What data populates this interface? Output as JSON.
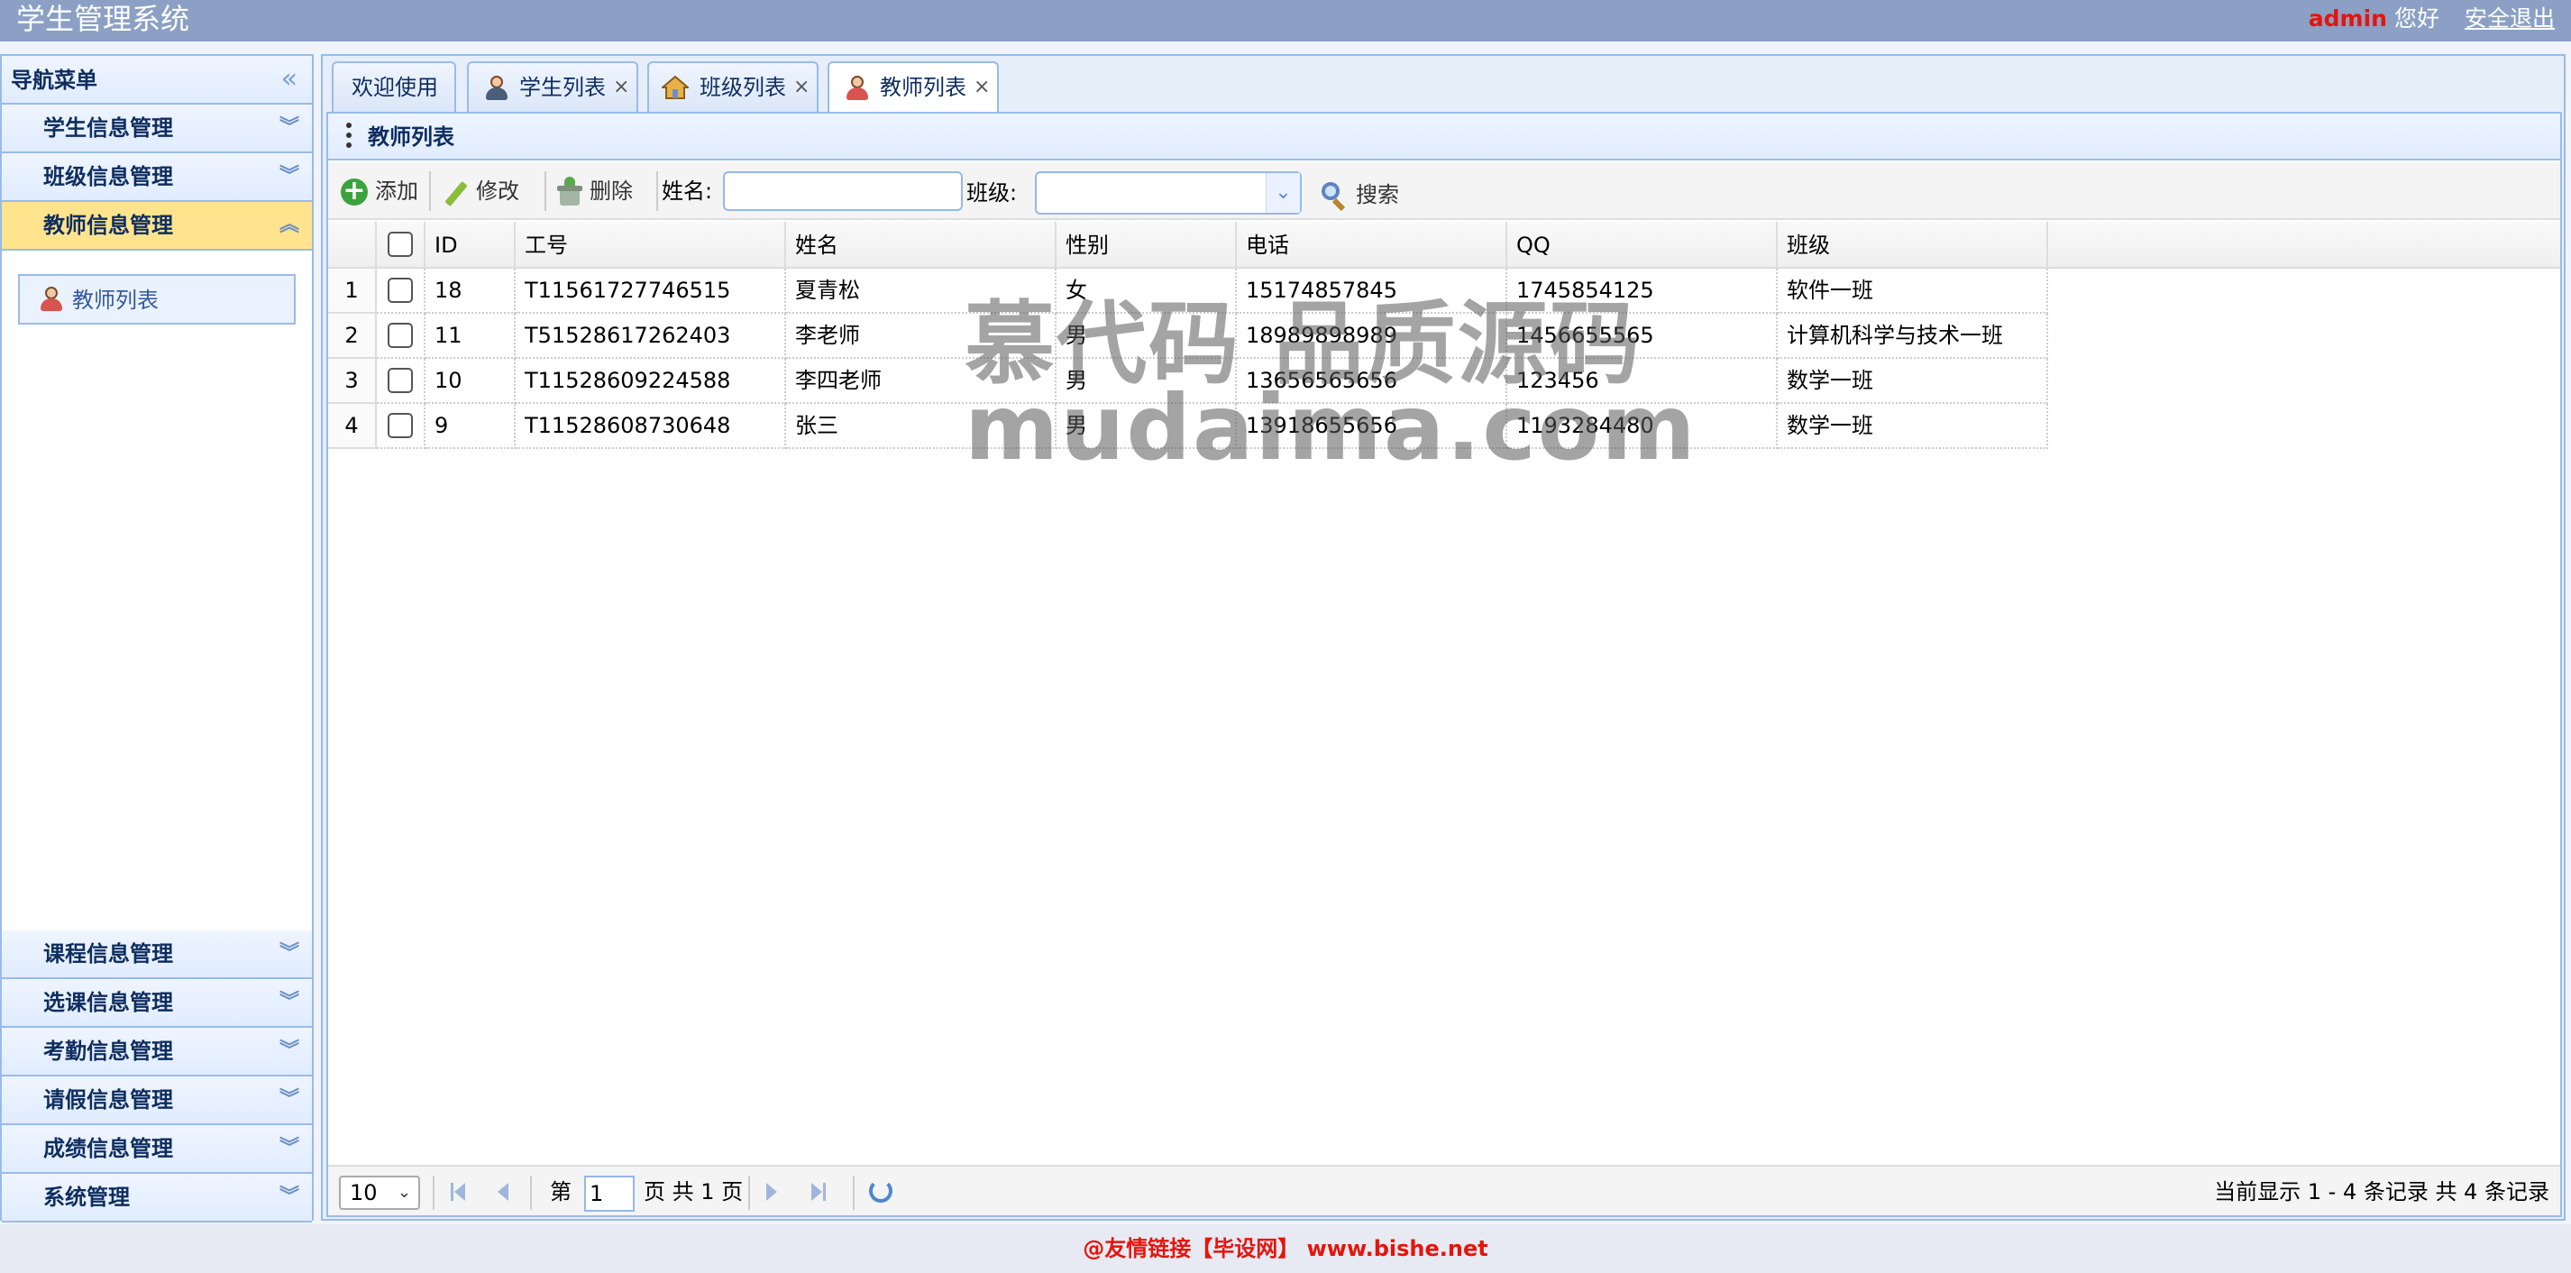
{
  "header": {
    "app_title": "学生管理系统",
    "user_name": "admin",
    "greeting": "您好",
    "logout": "安全退出"
  },
  "nav": {
    "title": "导航菜单",
    "collapse_icon": "double-chevron-left-icon",
    "top_sections": [
      {
        "label": "学生信息管理"
      },
      {
        "label": "班级信息管理"
      },
      {
        "label": "教师信息管理",
        "active": true
      }
    ],
    "active_items": [
      {
        "label": "教师列表",
        "icon": "teacher-icon"
      }
    ],
    "bottom_sections": [
      {
        "label": "课程信息管理"
      },
      {
        "label": "选课信息管理"
      },
      {
        "label": "考勤信息管理"
      },
      {
        "label": "请假信息管理"
      },
      {
        "label": "成绩信息管理"
      },
      {
        "label": "系统管理"
      }
    ]
  },
  "tabs": [
    {
      "label": "欢迎使用",
      "closable": false
    },
    {
      "label": "学生列表",
      "icon": "student-icon",
      "closable": true
    },
    {
      "label": "班级列表",
      "icon": "house-icon",
      "closable": true
    },
    {
      "label": "教师列表",
      "icon": "teacher-icon",
      "closable": true,
      "active": true
    }
  ],
  "panel": {
    "title": "教师列表"
  },
  "toolbar": {
    "add": "添加",
    "edit": "修改",
    "delete": "删除",
    "name_label": "姓名:",
    "name_value": "",
    "class_label": "班级:",
    "class_value": "",
    "search": "搜索"
  },
  "table": {
    "columns": [
      "ID",
      "工号",
      "姓名",
      "性别",
      "电话",
      "QQ",
      "班级"
    ],
    "rows": [
      {
        "num": "1",
        "id": "18",
        "number": "T11561727746515",
        "name": "夏青松",
        "gender": "女",
        "phone": "15174857845",
        "qq": "1745854125",
        "clazz": "软件一班"
      },
      {
        "num": "2",
        "id": "11",
        "number": "T51528617262403",
        "name": "李老师",
        "gender": "男",
        "phone": "18989898989",
        "qq": "1456655565",
        "clazz": "计算机科学与技术一班"
      },
      {
        "num": "3",
        "id": "10",
        "number": "T11528609224588",
        "name": "李四老师",
        "gender": "男",
        "phone": "13656565656",
        "qq": "123456",
        "clazz": "数学一班"
      },
      {
        "num": "4",
        "id": "9",
        "number": "T11528608730648",
        "name": "张三",
        "gender": "男",
        "phone": "13918655656",
        "qq": "1193284480",
        "clazz": "数学一班"
      }
    ]
  },
  "pager": {
    "page_size": "10",
    "page_prefix": "第",
    "page_value": "1",
    "page_suffix": "页 共 1 页",
    "info": "当前显示 1 - 4 条记录 共 4 条记录"
  },
  "watermark": {
    "line1": "慕代码 品质源码",
    "line2": "mudaima.com"
  },
  "footer": {
    "text": "@友情链接【毕设网】 www.bishe.net"
  },
  "colors": {
    "header_bg": "#8ba0c4",
    "accent_border": "#99bbe8",
    "active_section": "#ffe48d",
    "footer_text": "#e5140c"
  }
}
